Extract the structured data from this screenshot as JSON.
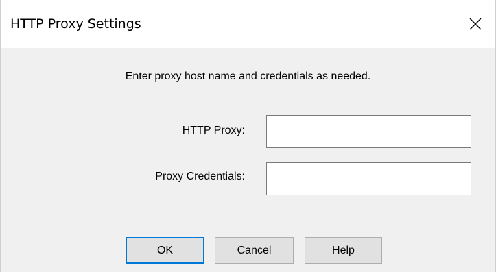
{
  "window": {
    "title": "HTTP Proxy Settings"
  },
  "instruction": "Enter proxy host name and credentials as needed.",
  "fields": {
    "proxy": {
      "label": "HTTP Proxy:",
      "value": ""
    },
    "credentials": {
      "label": "Proxy Credentials:",
      "value": ""
    }
  },
  "buttons": {
    "ok": "OK",
    "cancel": "Cancel",
    "help": "Help"
  },
  "icons": {
    "close": "close-icon"
  },
  "colors": {
    "default_button_border": "#0078d7",
    "dialog_background": "#f0f0f0",
    "titlebar_background": "#ffffff"
  }
}
